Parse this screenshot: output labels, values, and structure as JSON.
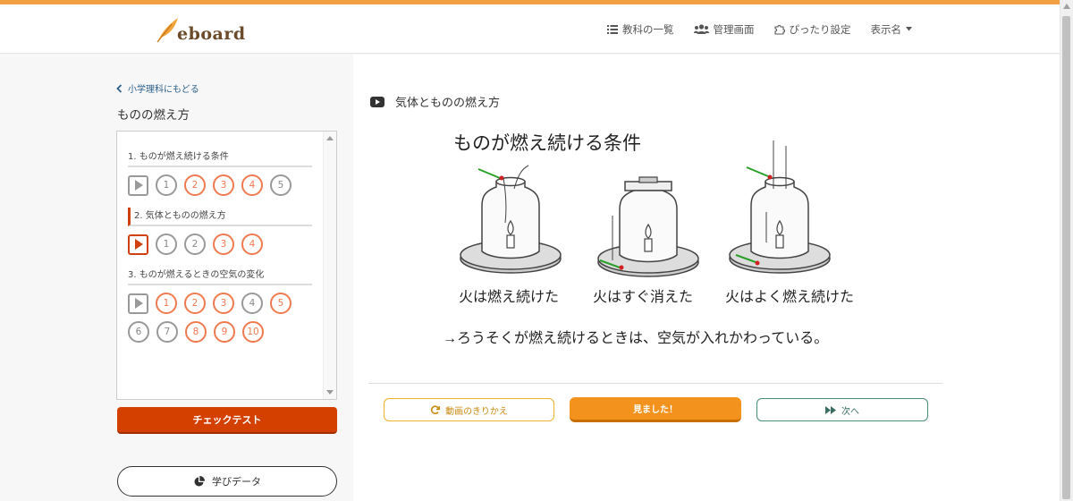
{
  "app": {
    "logo_text": "eboard",
    "brand_color": "#f0a040"
  },
  "nav": {
    "items": [
      {
        "icon": "list-icon",
        "label": "教科の一覧"
      },
      {
        "icon": "users-icon",
        "label": "管理画面"
      },
      {
        "icon": "puzzle-icon",
        "label": "ぴったり設定"
      },
      {
        "icon": "caret-down-icon",
        "label": "表示名"
      }
    ]
  },
  "sidebar": {
    "back_label": "小学理科にもどる",
    "course_title": "ものの燃え方",
    "lessons": [
      {
        "title": "1. ものが燃え続ける条件",
        "active": false,
        "rows": [
          [
            {
              "n": "1",
              "done": false
            },
            {
              "n": "2",
              "done": true
            },
            {
              "n": "3",
              "done": true
            },
            {
              "n": "4",
              "done": true
            },
            {
              "n": "5",
              "done": false
            }
          ]
        ]
      },
      {
        "title": "2. 気体とものの燃え方",
        "active": true,
        "rows": [
          [
            {
              "n": "1",
              "done": false
            },
            {
              "n": "2",
              "done": false
            },
            {
              "n": "3",
              "done": true
            },
            {
              "n": "4",
              "done": true
            }
          ]
        ]
      },
      {
        "title": "3. ものが燃えるときの空気の変化",
        "active": false,
        "rows": [
          [
            {
              "n": "1",
              "done": true
            },
            {
              "n": "2",
              "done": true
            },
            {
              "n": "3",
              "done": true
            },
            {
              "n": "4",
              "done": false
            },
            {
              "n": "5",
              "done": true
            }
          ],
          [
            {
              "n": "6",
              "done": false
            },
            {
              "n": "7",
              "done": false
            },
            {
              "n": "8",
              "done": true
            },
            {
              "n": "9",
              "done": true
            },
            {
              "n": "10",
              "done": true
            }
          ]
        ]
      }
    ],
    "check_test_label": "チェックテスト",
    "learning_data_label": "学びデータ"
  },
  "main": {
    "video_title": "気体とものの燃え方",
    "slide": {
      "heading": "ものが燃え続ける条件",
      "captions": [
        "火は燃え続けた",
        "火はすぐ消えた",
        "火はよく燃え続けた"
      ],
      "conclusion": "→ろうそくが燃え続けるときは、空気が入れかわっている。"
    },
    "buttons": {
      "switch_label": "動画のきりかえ",
      "seen_label": "見ました！",
      "next_label": "次へ"
    }
  }
}
